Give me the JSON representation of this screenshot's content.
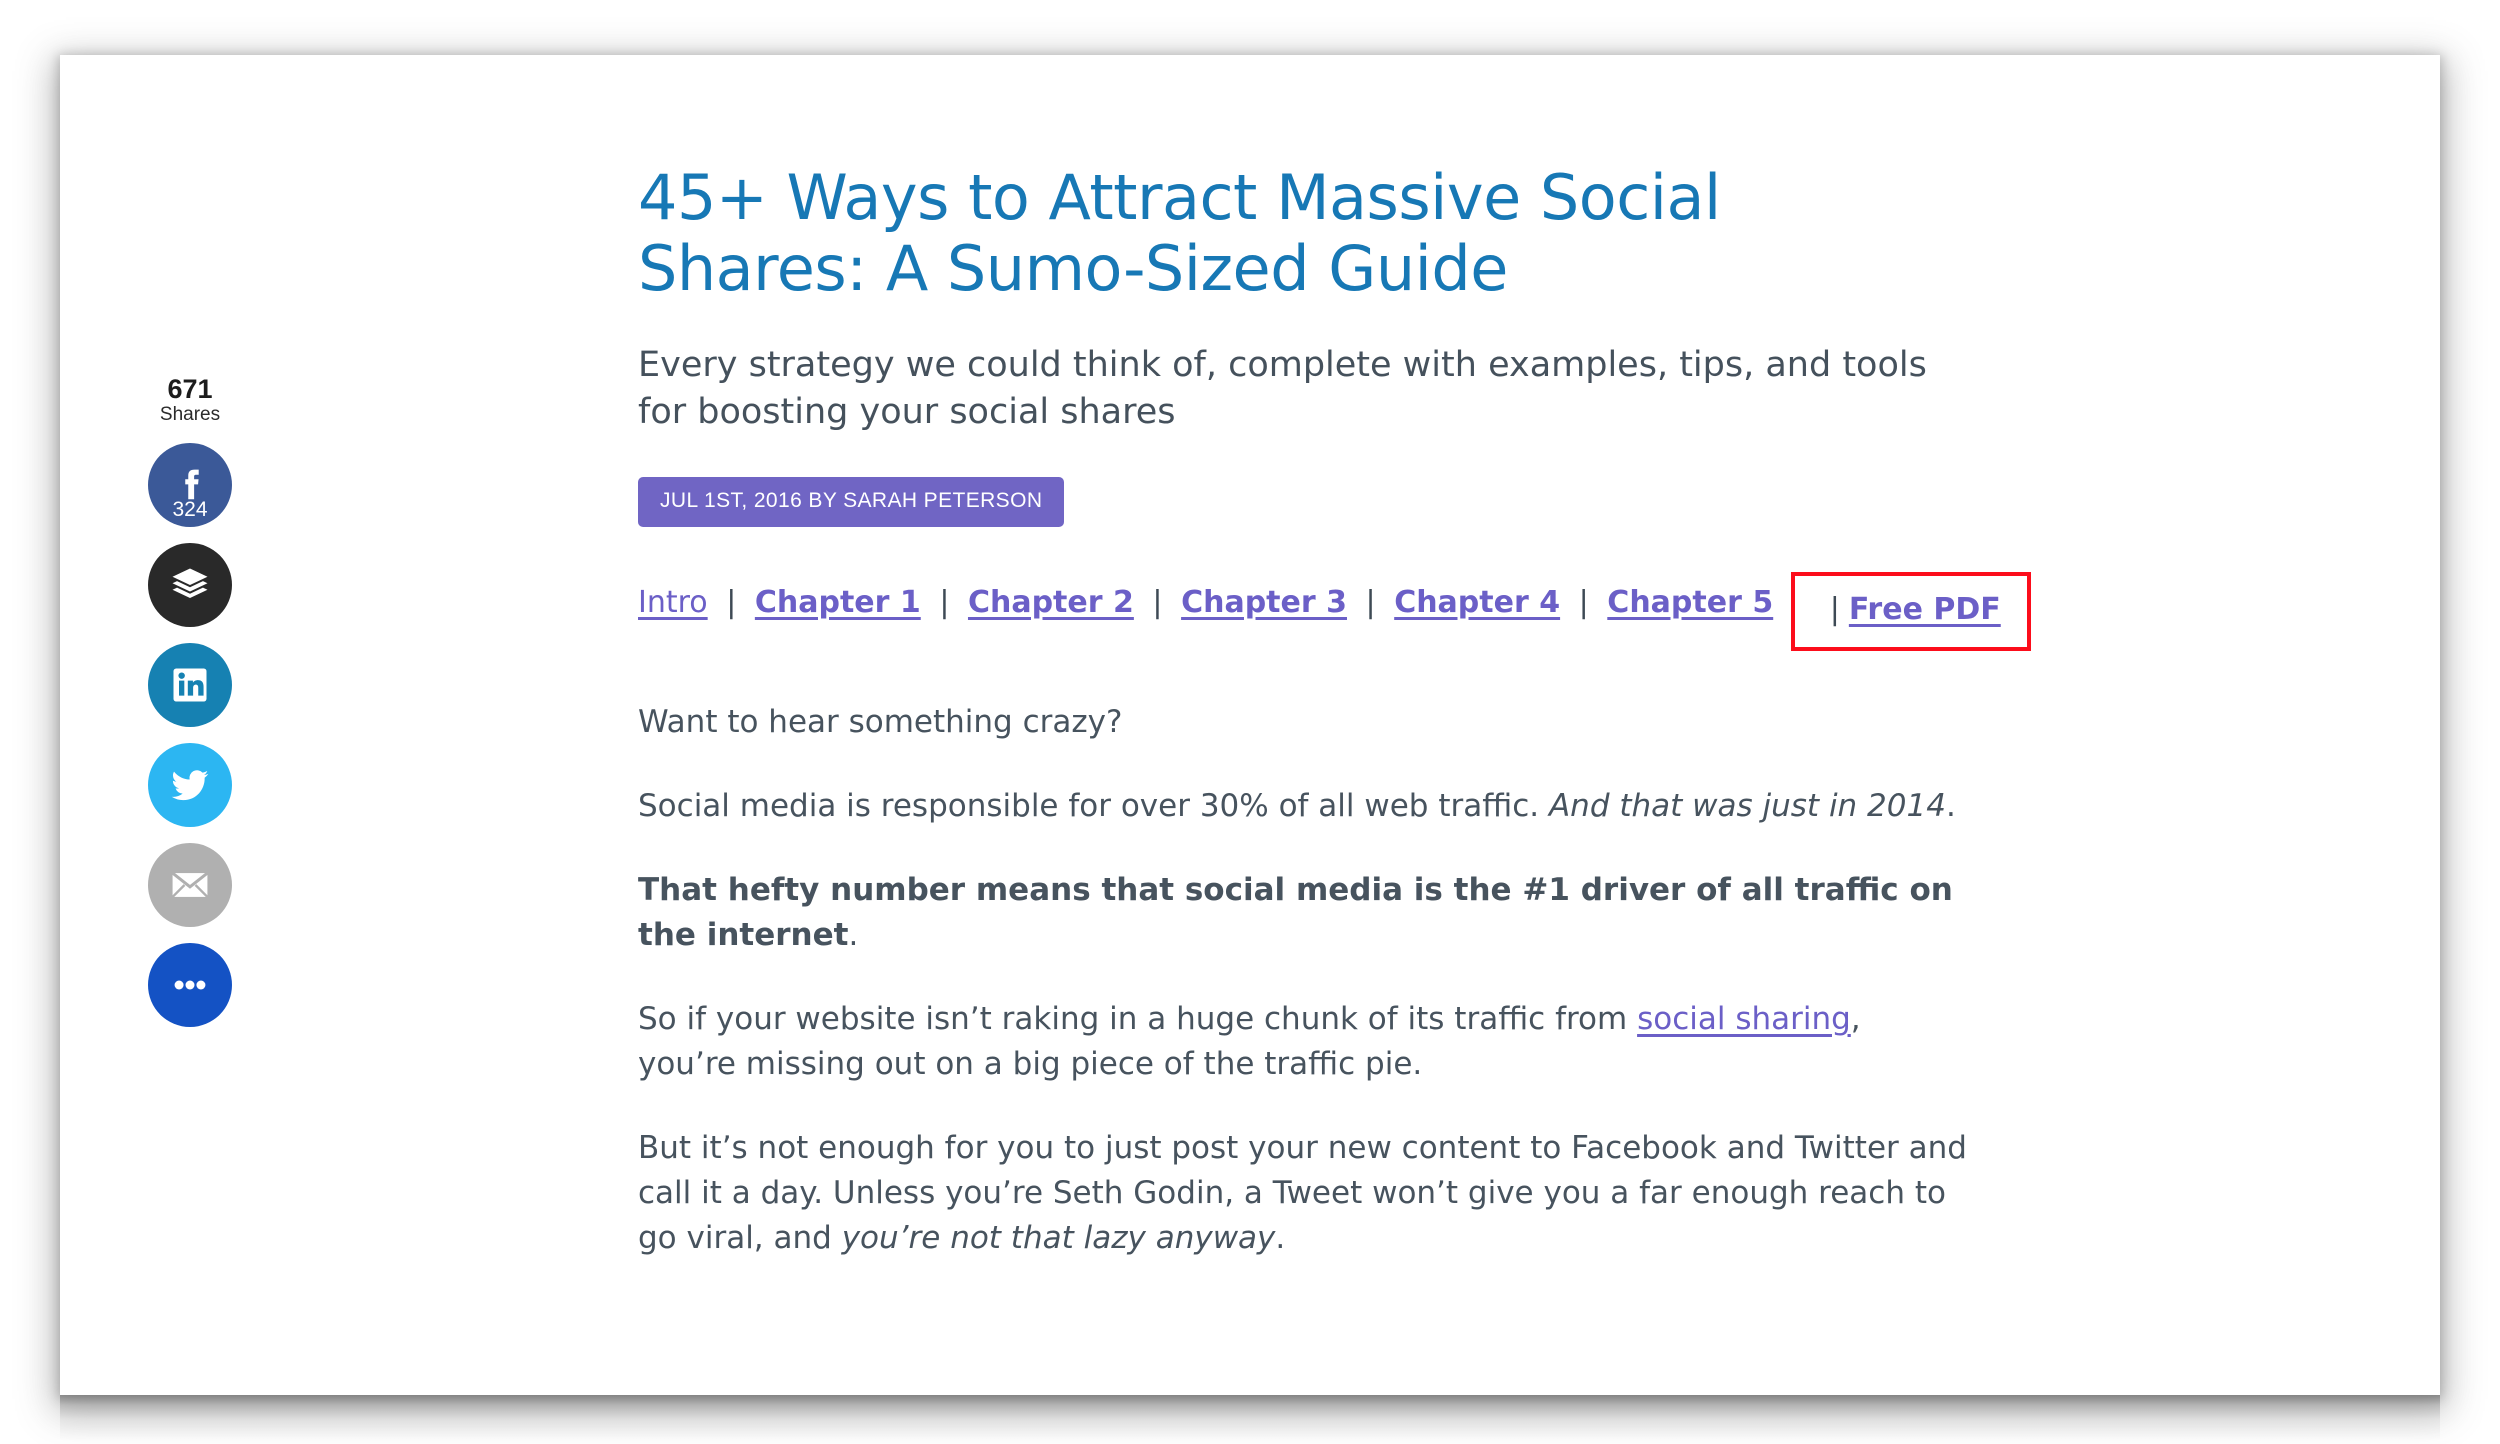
{
  "share_rail": {
    "total_count": "671",
    "total_label": "Shares",
    "buttons": [
      {
        "icon": "facebook-icon",
        "name": "facebook",
        "count": "324",
        "color": "#3b5998"
      },
      {
        "icon": "buffer-icon",
        "name": "buffer",
        "count": "",
        "color": "#292929"
      },
      {
        "icon": "linkedin-icon",
        "name": "linkedin",
        "count": "",
        "color": "#1681b2"
      },
      {
        "icon": "twitter-icon",
        "name": "twitter",
        "count": "",
        "color": "#2cb6f2"
      },
      {
        "icon": "email-icon",
        "name": "email",
        "count": "",
        "color": "#b0b0b0"
      },
      {
        "icon": "more-options-icon",
        "name": "more",
        "count": "",
        "color": "#1452c4"
      }
    ]
  },
  "article": {
    "title": "45+ Ways to Attract Massive Social Shares: A Sumo-Sized Guide",
    "subtitle": "Every strategy we could think of, complete with examples, tips, and tools for boosting your social shares",
    "meta_badge": "JUL 1ST, 2016 BY SARAH PETERSON",
    "nav": {
      "separator": "|",
      "links": [
        {
          "label": "Intro",
          "bold": false
        },
        {
          "label": "Chapter 1",
          "bold": true
        },
        {
          "label": "Chapter 2",
          "bold": true
        },
        {
          "label": "Chapter 3",
          "bold": true
        },
        {
          "label": "Chapter 4",
          "bold": true
        },
        {
          "label": "Chapter 5",
          "bold": true
        }
      ],
      "free_pdf_label": "Free PDF",
      "highlight_color": "#fc0d1b"
    },
    "paragraphs": {
      "p1": "Want to hear something crazy?",
      "p2_plain": "Social media is responsible for over 30% of all web traffic. ",
      "p2_italic": "And that was just in 2014",
      "p2_tail": ".",
      "p3_bold": "That hefty number means that social media is the #1 driver of all traffic on the internet",
      "p3_tail": ".",
      "p4_start": "So if your website isn’t raking in a huge chunk of its traffic from ",
      "p4_link": "social sharing",
      "p4_end": ", you’re missing out on a big piece of the traffic pie.",
      "p5_start": "But it’s not enough for you to just post your new content to Facebook and Twitter and call it a day. Unless you’re Seth Godin, a Tweet won’t give you a far enough reach to go viral, and ",
      "p5_italic": "you’re not that lazy anyway",
      "p5_end": "."
    }
  },
  "colors": {
    "title_blue": "#1778b5",
    "link_purple": "#6b5fc7",
    "badge_purple": "#7065c4",
    "body_gray": "#47535e"
  }
}
